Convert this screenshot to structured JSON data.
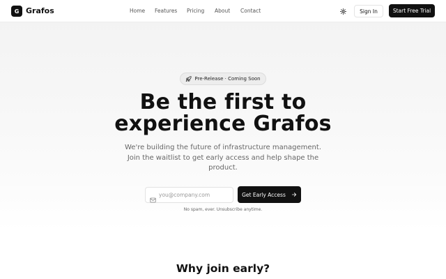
{
  "header": {
    "logo_mark": "G",
    "brand": "Grafos",
    "nav": [
      {
        "label": "Home",
        "icon": null
      },
      {
        "label": "Features",
        "icon": null
      },
      {
        "label": "Pricing",
        "icon": null
      },
      {
        "label": "About",
        "icon": null
      },
      {
        "label": "Contact",
        "icon": null
      }
    ],
    "theme_icon": "sun-icon",
    "sign_in_label": "Sign In",
    "trial_label": "Start Free Trial"
  },
  "hero": {
    "badge_icon": "rocket-icon",
    "badge_label": "Pre-Release · Coming Soon",
    "title_line1": "Be the first to",
    "title_line2": "experience Grafos",
    "subtitle": "We're building the future of infrastructure management. Join the waitlist to get early access and help shape the product.",
    "email_icon": "mail-icon",
    "email_placeholder": "you@company.com",
    "email_value": "",
    "cta_label": "Get Early Access",
    "cta_icon": "arrow-right-icon",
    "note": "No spam, ever. Unsubscribe anytime."
  },
  "section": {
    "why_title": "Why join early?"
  },
  "colors": {
    "primary": "#111111",
    "text_muted": "#666666",
    "background": "#f5f5f5"
  }
}
